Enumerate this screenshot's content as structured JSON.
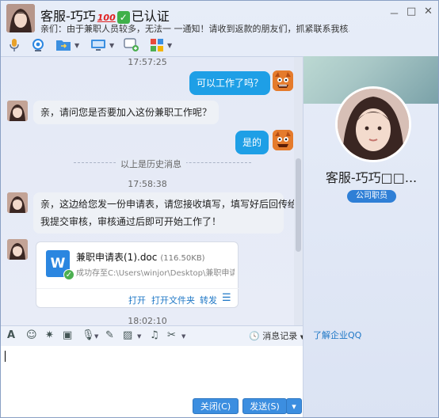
{
  "header": {
    "name": "客服-巧巧",
    "badge_100": "100",
    "verified_text": "已认证",
    "signature": "亲们：由于兼职人员较多，无法一 一通知！请收到返款的朋友们，抓紧联系我核...",
    "minimize": "－",
    "maximize": "□",
    "close": "✕"
  },
  "messages": {
    "ts1": "17:57:25",
    "self1": "可以工作了吗？",
    "other1": "亲，请问您是否要加入这份兼职工作呢？",
    "self2": "是的",
    "ts2": "17:58:38",
    "history_divider": "以上是历史消息",
    "other2_line1": "亲，这边给您发一份申请表，请您接收填写，填写好后回传给",
    "other2_line2": "我提交审核，审核通过后即可开始工作了！",
    "ts3": "18:02:10"
  },
  "file": {
    "icon_letter": "W",
    "name": "兼职申请表(1).doc",
    "size": "(116.50KB)",
    "status": "成功存至C:\\Users\\winjor\\Desktop\\兼职申请...",
    "open": "打开",
    "open_folder": "打开文件夹",
    "forward": "转发",
    "menu": "☰"
  },
  "input_toolbar": {
    "history": "消息记录"
  },
  "buttons": {
    "close": "关闭(C)",
    "send": "发送(S)",
    "send_caret": "▾"
  },
  "right_panel": {
    "name": "客服-巧巧□□...",
    "badge": "公司职员",
    "learn_link": "了解企业QQ"
  }
}
